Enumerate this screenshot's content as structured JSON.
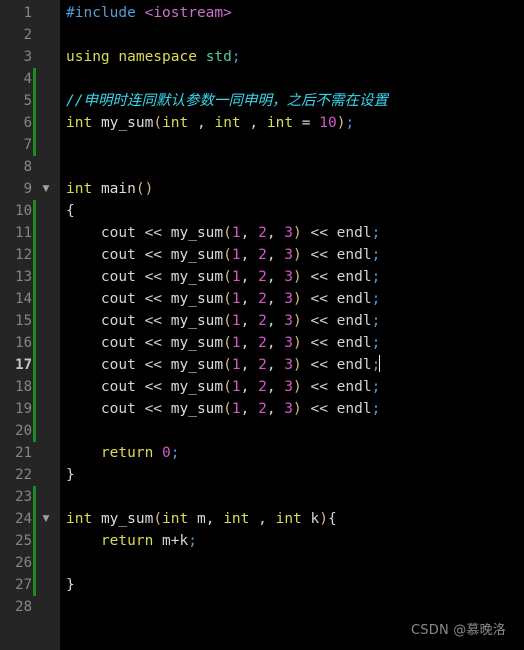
{
  "editor": {
    "background": "#000000",
    "gutter_background": "#252526",
    "change_bar_color": "#1f8a1f",
    "active_line_number": 17,
    "cursor": {
      "line": 17,
      "after_text": "endl;"
    },
    "total_lines": 28
  },
  "gutter": {
    "line_numbers": [
      "1",
      "2",
      "3",
      "4",
      "5",
      "6",
      "7",
      "8",
      "9",
      "10",
      "11",
      "12",
      "13",
      "14",
      "15",
      "16",
      "17",
      "18",
      "19",
      "20",
      "21",
      "22",
      "23",
      "24",
      "25",
      "26",
      "27",
      "28"
    ],
    "fold_arrows": [
      {
        "line": 9,
        "icon": "chevron-down-icon",
        "glyph": "▼"
      },
      {
        "line": 24,
        "icon": "chevron-down-icon",
        "glyph": "▼"
      }
    ],
    "change_bar_ranges": [
      {
        "from_line": 4,
        "to_line": 7
      },
      {
        "from_line": 10,
        "to_line": 20
      },
      {
        "from_line": 23,
        "to_line": 27
      }
    ]
  },
  "code": {
    "language": "cpp",
    "lines": [
      {
        "n": 1,
        "text": "#include <iostream>"
      },
      {
        "n": 2,
        "text": ""
      },
      {
        "n": 3,
        "text": "using namespace std;"
      },
      {
        "n": 4,
        "text": ""
      },
      {
        "n": 5,
        "text": "//申明时连同默认参数一同申明，之后不需在设置"
      },
      {
        "n": 6,
        "text": "int my_sum(int , int , int = 10);"
      },
      {
        "n": 7,
        "text": ""
      },
      {
        "n": 8,
        "text": ""
      },
      {
        "n": 9,
        "text": "int main()"
      },
      {
        "n": 10,
        "text": "{"
      },
      {
        "n": 11,
        "text": "    cout << my_sum(1, 2, 3) << endl;"
      },
      {
        "n": 12,
        "text": "    cout << my_sum(1, 2, 3) << endl;"
      },
      {
        "n": 13,
        "text": "    cout << my_sum(1, 2, 3) << endl;"
      },
      {
        "n": 14,
        "text": "    cout << my_sum(1, 2, 3) << endl;"
      },
      {
        "n": 15,
        "text": "    cout << my_sum(1, 2, 3) << endl;"
      },
      {
        "n": 16,
        "text": "    cout << my_sum(1, 2, 3) << endl;"
      },
      {
        "n": 17,
        "text": "    cout << my_sum(1, 2, 3) << endl;"
      },
      {
        "n": 18,
        "text": "    cout << my_sum(1, 2, 3) << endl;"
      },
      {
        "n": 19,
        "text": "    cout << my_sum(1, 2, 3) << endl;"
      },
      {
        "n": 20,
        "text": ""
      },
      {
        "n": 21,
        "text": "    return 0;"
      },
      {
        "n": 22,
        "text": "}"
      },
      {
        "n": 23,
        "text": ""
      },
      {
        "n": 24,
        "text": "int my_sum(int m, int , int k){"
      },
      {
        "n": 25,
        "text": "    return m+k;"
      },
      {
        "n": 26,
        "text": ""
      },
      {
        "n": 27,
        "text": "}"
      },
      {
        "n": 28,
        "text": ""
      }
    ]
  },
  "tokens": {
    "l1": [
      {
        "t": "#include",
        "c": "t-pre"
      },
      {
        "t": " ",
        "c": "t-plain"
      },
      {
        "t": "<iostream>",
        "c": "t-header"
      }
    ],
    "l3": [
      {
        "t": "using",
        "c": "t-key"
      },
      {
        "t": " ",
        "c": "t-plain"
      },
      {
        "t": "namespace",
        "c": "t-key"
      },
      {
        "t": " ",
        "c": "t-plain"
      },
      {
        "t": "std",
        "c": "t-ns"
      },
      {
        "t": ";",
        "c": "t-punc"
      }
    ],
    "l5": [
      {
        "t": "//申明时连同默认参数一同申明，之后不需在设置",
        "c": "t-comment"
      }
    ],
    "l6": [
      {
        "t": "int",
        "c": "t-key"
      },
      {
        "t": " ",
        "c": "t-plain"
      },
      {
        "t": "my_sum",
        "c": "t-fn"
      },
      {
        "t": "(",
        "c": "t-paren"
      },
      {
        "t": "int",
        "c": "t-key"
      },
      {
        "t": " , ",
        "c": "t-plain"
      },
      {
        "t": "int",
        "c": "t-key"
      },
      {
        "t": " , ",
        "c": "t-plain"
      },
      {
        "t": "int",
        "c": "t-key"
      },
      {
        "t": " = ",
        "c": "t-plain"
      },
      {
        "t": "10",
        "c": "t-num"
      },
      {
        "t": ")",
        "c": "t-paren"
      },
      {
        "t": ";",
        "c": "t-punc"
      }
    ],
    "l9": [
      {
        "t": "int",
        "c": "t-key"
      },
      {
        "t": " ",
        "c": "t-plain"
      },
      {
        "t": "main",
        "c": "t-fn"
      },
      {
        "t": "()",
        "c": "t-paren"
      }
    ],
    "l10": [
      {
        "t": "{",
        "c": "t-brace"
      }
    ],
    "lcout": [
      {
        "t": "    cout << ",
        "c": "t-plain"
      },
      {
        "t": "my_sum",
        "c": "t-fn"
      },
      {
        "t": "(",
        "c": "t-paren"
      },
      {
        "t": "1",
        "c": "t-num"
      },
      {
        "t": ", ",
        "c": "t-plain"
      },
      {
        "t": "2",
        "c": "t-num"
      },
      {
        "t": ", ",
        "c": "t-plain"
      },
      {
        "t": "3",
        "c": "t-num"
      },
      {
        "t": ")",
        "c": "t-paren"
      },
      {
        "t": " << endl",
        "c": "t-plain"
      },
      {
        "t": ";",
        "c": "t-punc"
      }
    ],
    "l21": [
      {
        "t": "    ",
        "c": "t-plain"
      },
      {
        "t": "return",
        "c": "t-key"
      },
      {
        "t": " ",
        "c": "t-plain"
      },
      {
        "t": "0",
        "c": "t-num"
      },
      {
        "t": ";",
        "c": "t-punc"
      }
    ],
    "l22": [
      {
        "t": "}",
        "c": "t-brace"
      }
    ],
    "l24": [
      {
        "t": "int",
        "c": "t-key"
      },
      {
        "t": " ",
        "c": "t-plain"
      },
      {
        "t": "my_sum",
        "c": "t-fn"
      },
      {
        "t": "(",
        "c": "t-paren"
      },
      {
        "t": "int",
        "c": "t-key"
      },
      {
        "t": " m, ",
        "c": "t-plain"
      },
      {
        "t": "int",
        "c": "t-key"
      },
      {
        "t": " , ",
        "c": "t-plain"
      },
      {
        "t": "int",
        "c": "t-key"
      },
      {
        "t": " k",
        "c": "t-plain"
      },
      {
        "t": ")",
        "c": "t-paren"
      },
      {
        "t": "{",
        "c": "t-brace"
      }
    ],
    "l25": [
      {
        "t": "    ",
        "c": "t-plain"
      },
      {
        "t": "return",
        "c": "t-key"
      },
      {
        "t": " m+k",
        "c": "t-plain"
      },
      {
        "t": ";",
        "c": "t-punc"
      }
    ],
    "l27": [
      {
        "t": "}",
        "c": "t-brace"
      }
    ]
  },
  "watermark": {
    "text": "CSDN @慕晚洛"
  }
}
